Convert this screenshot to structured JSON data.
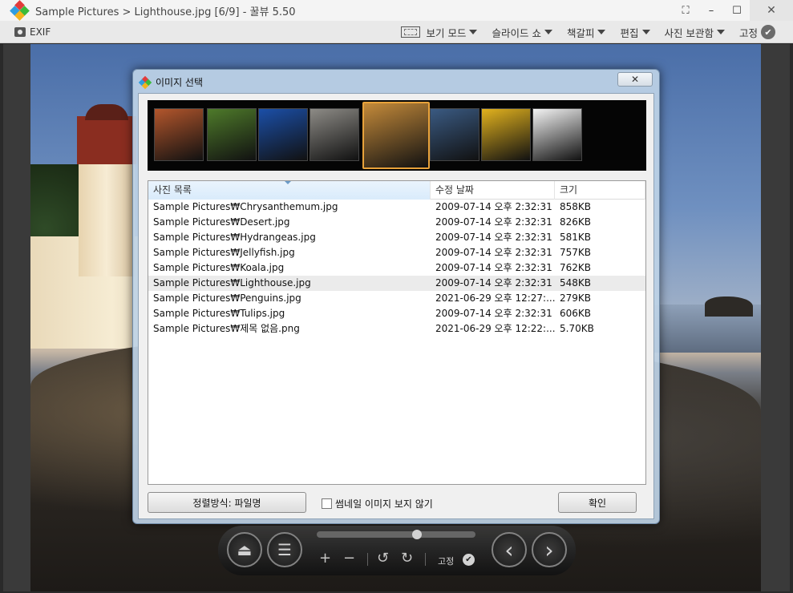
{
  "window": {
    "title": "Sample Pictures > Lighthouse.jpg [6/9] - 꿀뷰 5.50",
    "minimize": "–",
    "maximize": "☐",
    "close": "✕",
    "fit": "⛶"
  },
  "toolbar": {
    "exif_label": "EXIF",
    "view_mode": "보기 모드",
    "slideshow": "슬라이드 쇼",
    "bookmark": "책갈피",
    "edit": "편집",
    "photo_archive": "사진 보관함",
    "pin": "고정"
  },
  "dialog": {
    "title": "이미지 선택",
    "close": "✕",
    "columns": [
      "사진 목록",
      "수정 날짜",
      "크기"
    ],
    "files": [
      {
        "name": "Sample Pictures₩Chrysanthemum.jpg",
        "date": "2009-07-14 오후 2:32:31",
        "size": "858KB"
      },
      {
        "name": "Sample Pictures₩Desert.jpg",
        "date": "2009-07-14 오후 2:32:31",
        "size": "826KB"
      },
      {
        "name": "Sample Pictures₩Hydrangeas.jpg",
        "date": "2009-07-14 오후 2:32:31",
        "size": "581KB"
      },
      {
        "name": "Sample Pictures₩Jellyfish.jpg",
        "date": "2009-07-14 오후 2:32:31",
        "size": "757KB"
      },
      {
        "name": "Sample Pictures₩Koala.jpg",
        "date": "2009-07-14 오후 2:32:31",
        "size": "762KB"
      },
      {
        "name": "Sample Pictures₩Lighthouse.jpg",
        "date": "2009-07-14 오후 2:32:31",
        "size": "548KB"
      },
      {
        "name": "Sample Pictures₩Penguins.jpg",
        "date": "2021-06-29 오후 12:27:...",
        "size": "279KB"
      },
      {
        "name": "Sample Pictures₩Tulips.jpg",
        "date": "2009-07-14 오후 2:32:31",
        "size": "606KB"
      },
      {
        "name": "Sample Pictures₩제목 없음.png",
        "date": "2021-06-29 오후 12:22:...",
        "size": "5.70KB"
      }
    ],
    "selected_index": 5,
    "sort_button": "정렬방식: 파일명",
    "hide_thumbnails": "썸네일 이미지 보지 않기",
    "ok_button": "확인",
    "thumb_colors": [
      "#b3562c",
      "#4e7a2a",
      "#1b4fa8",
      "#8d8b86",
      "#c48a3a",
      "#3a5a82",
      "#e2b21e",
      "#f4f4f4"
    ]
  },
  "controls": {
    "eject": "⏏",
    "menu": "☰",
    "zoom_in": "+",
    "zoom_out": "−",
    "rotate_left": "↺",
    "rotate_right": "↻",
    "pin": "고정",
    "check": "✔",
    "prev": "‹",
    "next": "›",
    "progress": 0.63
  }
}
